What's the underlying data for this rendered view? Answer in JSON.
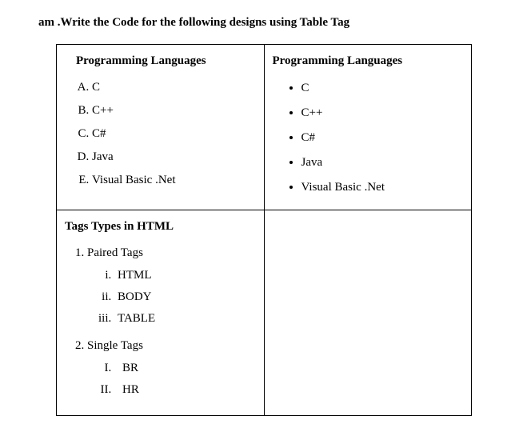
{
  "title": "am .Write the Code for the following designs using Table Tag",
  "row1": {
    "left": {
      "heading": "Programming Languages",
      "items": [
        "C",
        "C++",
        "C#",
        "Java",
        "Visual Basic .Net"
      ]
    },
    "right": {
      "heading": "Programming Languages",
      "items": [
        "C",
        "C++",
        "C#",
        "Java",
        "Visual Basic .Net"
      ]
    }
  },
  "row2": {
    "left": {
      "heading": "Tags Types in HTML",
      "groups": [
        {
          "label": "Paired Tags",
          "style": "lower-roman",
          "items": [
            "HTML",
            "BODY",
            "TABLE"
          ]
        },
        {
          "label": "Single Tags",
          "style": "upper-roman",
          "items": [
            "BR",
            "HR"
          ]
        }
      ]
    }
  }
}
